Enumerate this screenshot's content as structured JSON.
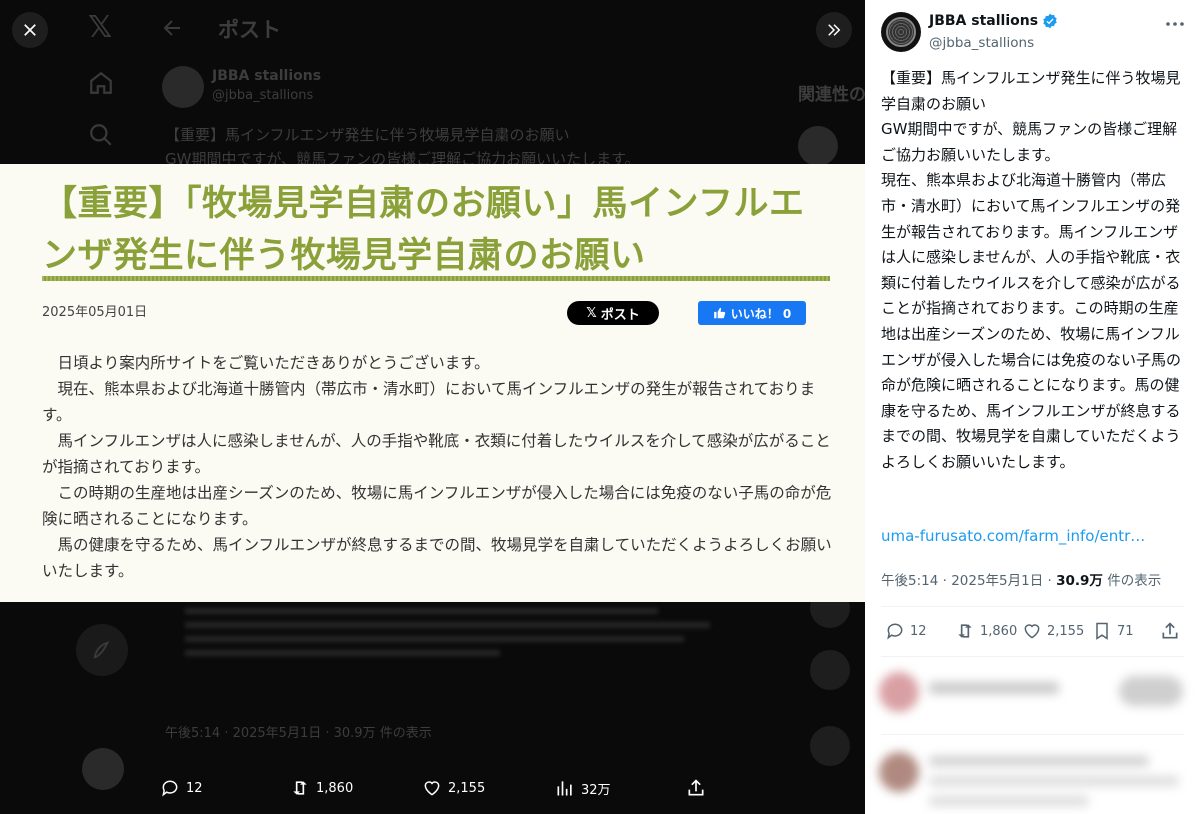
{
  "colors": {
    "accent": "#1d9bf0",
    "media_title": "#8aa039",
    "fb": "#1877f2"
  },
  "bg": {
    "header_title": "ポスト",
    "author_name": "JBBA stallions",
    "author_handle": "@jbba_stallions",
    "line1": "【重要】馬インフルエンザ発生に伴う牧場見学自粛のお願い",
    "line2": "GW期間中ですが、競馬ファンの皆様ご理解ご協力お願いいたします。",
    "related": "関連性の",
    "footer_meta": "午後5:14 · 2025年5月1日 · 30.9万 件の表示"
  },
  "media": {
    "title": "【重要】「牧場見学自粛のお願い」馬インフルエンザ発生に伴う牧場見学自粛のお願い",
    "date": "2025年05月01日",
    "x_post_label": "ポスト",
    "fb_like_label": "いいね！ 0",
    "paragraphs": [
      "日頃より案内所サイトをご覧いただきありがとうございます。",
      "現在、熊本県および北海道十勝管内（帯広市・清水町）において馬インフルエンザの発生が報告されております。",
      "馬インフルエンザは人に感染しませんが、人の手指や靴底・衣類に付着したウイルスを介して感染が広がることが指摘されております。",
      "この時期の生産地は出産シーズンのため、牧場に馬インフルエンザが侵入した場合には免疫のない子馬の命が危険に晒されることになります。",
      "馬の健康を守るため、馬インフルエンザが終息するまでの間、牧場見学を自粛していただくようよろしくお願いいたします。"
    ]
  },
  "bottom_bar": {
    "replies": "12",
    "reposts": "1,860",
    "likes": "2,155",
    "views": "32万"
  },
  "panel": {
    "author_name": "JBBA stallions",
    "author_handle": "@jbba_stallions",
    "tweet_text": "【重要】馬インフルエンザ発生に伴う牧場見学自粛のお願い\nGW期間中ですが、競馬ファンの皆様ご理解ご協力お願いいたします。\n現在、熊本県および北海道十勝管内（帯広市・清水町）において馬インフルエンザの発生が報告されております。馬インフルエンザは人に感染しませんが、人の手指や靴底・衣類に付着したウイルスを介して感染が広がることが指摘されております。この時期の生産地は出産シーズンのため、牧場に馬インフルエンザが侵入した場合には免疫のない子馬の命が危険に晒されることになります。馬の健康を守るため、馬インフルエンザが終息するまでの間、牧場見学を自粛していただくようよろしくお願いいたします。",
    "link": "uma-furusato.com/farm_info/entr…",
    "meta_time": "午後5:14 · 2025年5月1日 · ",
    "meta_views": "30.9万",
    "meta_views_suffix": " 件の表示",
    "replies": "12",
    "reposts": "1,860",
    "likes": "2,155",
    "bookmarks": "71"
  },
  "icons": [
    "close-icon",
    "x-logo-icon",
    "back-arrow-icon",
    "home-icon",
    "search-icon",
    "collapse-panel-icon",
    "verified-icon",
    "more-icon",
    "reply-icon",
    "repost-icon",
    "like-icon",
    "views-icon",
    "bookmark-icon",
    "share-icon",
    "compose-icon"
  ]
}
